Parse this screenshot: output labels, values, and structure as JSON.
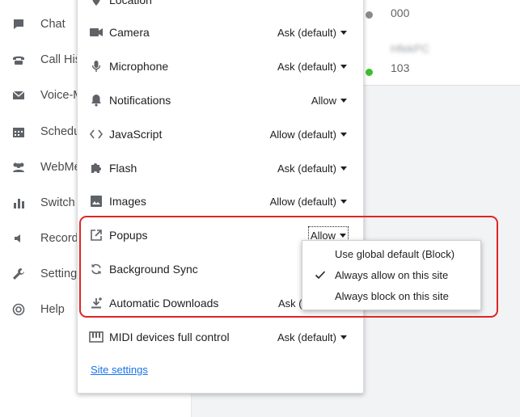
{
  "sidebar": {
    "items": [
      {
        "label": "Chat",
        "icon": "chat-icon"
      },
      {
        "label": "Call His",
        "icon": "phone-icon"
      },
      {
        "label": "Voice-M",
        "icon": "mail-icon"
      },
      {
        "label": "Schedu",
        "icon": "calendar-icon"
      },
      {
        "label": "WebMe",
        "icon": "people-icon"
      },
      {
        "label": "Switch",
        "icon": "bar-chart-icon"
      },
      {
        "label": "Record",
        "icon": "speaker-icon"
      },
      {
        "label": "Setting",
        "icon": "wrench-icon"
      },
      {
        "label": "Help",
        "icon": "lifebuoy-icon"
      }
    ]
  },
  "contacts": [
    {
      "name": "",
      "ext": "000",
      "avatar_color": "#3d3fd1",
      "status_color": "#8a8a8a"
    },
    {
      "name": "HfekPC",
      "ext": "103",
      "avatar_color": "#4a9a3a",
      "status_color": "#3cbf2c"
    }
  ],
  "site_info": {
    "permissions": [
      {
        "label": "Location",
        "value": "",
        "icon": "location-icon"
      },
      {
        "label": "Camera",
        "value": "Ask (default)",
        "icon": "camera-icon"
      },
      {
        "label": "Microphone",
        "value": "Ask (default)",
        "icon": "microphone-icon"
      },
      {
        "label": "Notifications",
        "value": "Allow",
        "icon": "bell-icon"
      },
      {
        "label": "JavaScript",
        "value": "Allow (default)",
        "icon": "code-icon"
      },
      {
        "label": "Flash",
        "value": "Ask (default)",
        "icon": "puzzle-icon"
      },
      {
        "label": "Images",
        "value": "Allow (default)",
        "icon": "image-icon"
      },
      {
        "label": "Popups",
        "value": "Allow",
        "icon": "open-in-new-icon"
      },
      {
        "label": "Background Sync",
        "value": "",
        "icon": "sync-icon"
      },
      {
        "label": "Automatic Downloads",
        "value": "Ask (",
        "icon": "download-icon"
      },
      {
        "label": "MIDI devices full control",
        "value": "Ask (default)",
        "icon": "piano-icon"
      }
    ],
    "site_settings_link": "Site settings"
  },
  "popup_dropdown": {
    "options": [
      {
        "label": "Use global default (Block)",
        "checked": false
      },
      {
        "label": "Always allow on this site",
        "checked": true
      },
      {
        "label": "Always block on this site",
        "checked": false
      }
    ]
  },
  "colors": {
    "annotation": "#e02424",
    "link": "#1a73e8",
    "panel_bg": "#f1f3f4"
  }
}
